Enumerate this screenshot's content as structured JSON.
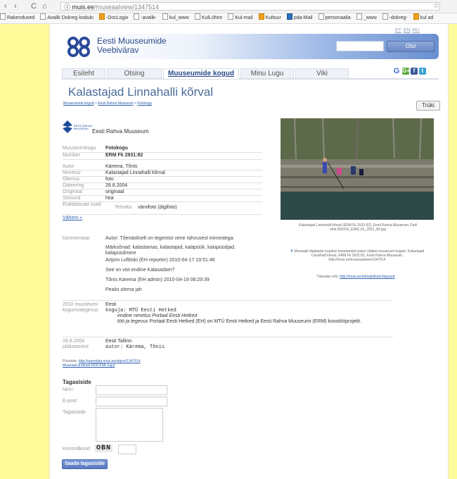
{
  "browser": {
    "url_host": "muis.ee",
    "url_path": "/museaalview/1347514",
    "bookmarks": [
      "Rakendused",
      "Avalik Dokreg kodulo",
      "-DocLogix",
      "-avalik-",
      "kul_www",
      "KulLühinr",
      "Kul-mail",
      "Kultuur",
      "pda-Mail",
      "personaalia",
      "_www",
      "-dokreg-",
      "kul ad"
    ]
  },
  "header": {
    "site_title_line1": "Eesti Muuseumide",
    "site_title_line2": "Veebivärav",
    "search_button": "Otsi",
    "languages": [
      "ET",
      "EN",
      "RU"
    ]
  },
  "tabs": [
    "Esileht",
    "Otsing",
    "Muuseumide kogud",
    "Minu Lugu",
    "Viki"
  ],
  "share_icons": [
    "G",
    "G+",
    "f",
    "t"
  ],
  "page": {
    "title": "Kalastajad Linnahalli kõrval",
    "breadcrumb": [
      "Muuseumide kogud",
      "Eesti Rahva Muuseum",
      "Fotokogu"
    ],
    "breadcrumb_sep": ">",
    "print_button": "Trüki"
  },
  "museum": {
    "logo_text1": "EESTI RAHVA",
    "logo_text2": "MUUSEUM",
    "name": "Eesti Rahva Muuseum"
  },
  "fields": [
    {
      "key": "Muuseumikogu",
      "value": "Fotokogu"
    },
    {
      "key": "Number",
      "value": "ERM Fk 2931:82"
    },
    {
      "key": "Autor",
      "value": "Kärema, Tõnis"
    },
    {
      "key": "Nimetus",
      "value": "Kalastajad Linnahalli kõrval"
    },
    {
      "key": "Olemus",
      "value": "foto"
    },
    {
      "key": "Dateering",
      "value": "28.8.2004"
    },
    {
      "key": "Originaal",
      "value": "originaal"
    },
    {
      "key": "Seisund",
      "value": "hea"
    },
    {
      "key": "Eraldatavad osad",
      "value": ""
    }
  ],
  "tehnika": {
    "key": "Tehnika",
    "value": "värvifoto (digifoto)"
  },
  "less_link": "Vähem «",
  "photo_caption": "Kalastajad Linnahalli kõrval (ERM Fk 2931:82), Eesti Rahva Muuseum, Faili nimi:302416_ERM_Fk_2931_82.jpg",
  "comments": {
    "label": "kommentaar",
    "lines": [
      "Autor: Tõenäoliselt on tegemist vene rahvusest inimestega.",
      "Märksõnad: kalastamas, kalastajad, kalapüük, kalapüüdjad, kalapüüdmine",
      "Artjom Loftitski (EH reporter) 2010-04-17 19:51:46",
      "See on vist endine Kalasadam?",
      "Tõnis Kärema (EH admin) 2010-04-19 08:29:39",
      "Peaks olema jah"
    ]
  },
  "license": {
    "text": "Museaali digitaalse kujutise kasutamisel palun viidata muuseumi kogule: Kalastajad Linnahalli kõrval, ERM Fk 2931:82, Eesti Rahva Muuseum, http://muis.ee/museaalview/1347514",
    "more_label": "Täiendav info:",
    "more_link": "http://muis.ee/et/help/Autoriõigused"
  },
  "event1": {
    "key1": "2010 muuseumi",
    "key2": "kogumistegevus",
    "v1": "Eesti",
    "v2": "koguja: MTÜ Eesti Hetked",
    "v3": "endine nimetus Portaal Eesti Hetked",
    "v4_label": "töö ja tegevus",
    "v4": "Portaal Eesti Hetked (EH) on MTÜ Eesti Hetked ja Eesti Rahva Muuseumi (ERM) koostööprojekt."
  },
  "event2": {
    "key1": "28.8.2004",
    "key2": "pildistamine",
    "v1": "Eesti Tallinn",
    "v2": "autor: Kärema, Tõnis"
  },
  "permalink": {
    "label": "Püsiviide:",
    "link": "http://opendata.muis.ee/object/1347514",
    "rdf": "Museaali andmed RDF/XML kujul"
  },
  "feedback": {
    "title": "Tagasiside",
    "name_label": "Nimi",
    "email_label": "E-post",
    "message_label": "Tagasiside",
    "captcha_label": "Kontrollkood",
    "captcha_code": "OBN",
    "submit": "Saada tagasiside"
  }
}
